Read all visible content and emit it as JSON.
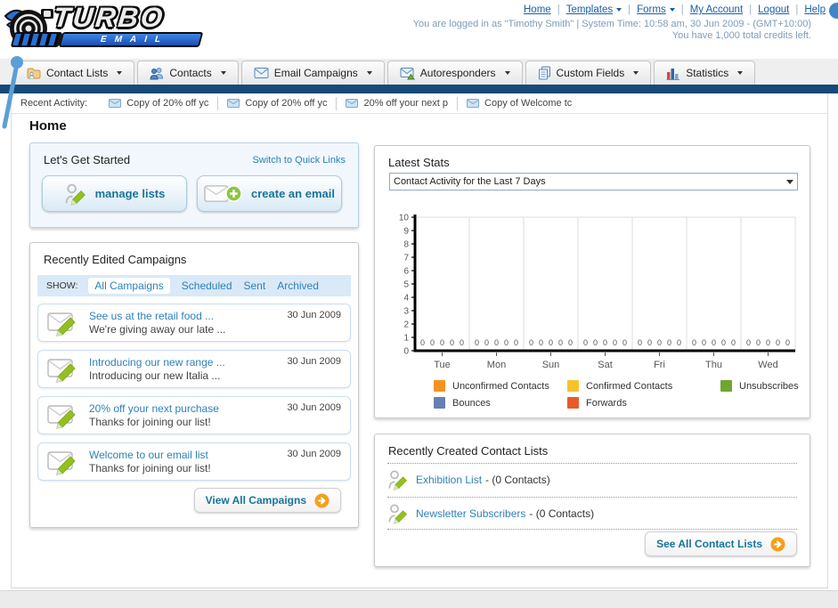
{
  "colors": {
    "navy_bar": "#164a79",
    "link_blue": "#1a5fa8",
    "teal_link": "#2e81b8",
    "go_arrow_orange": "#f5a01a",
    "panel_blue_bg": "#f1f7fc",
    "tabstrip_blue": "#d9e9f7"
  },
  "header": {
    "logo_line1": "TURBO",
    "logo_line2": "EMAIL",
    "nav": [
      {
        "label": "Home"
      },
      {
        "label": "Templates"
      },
      {
        "label": "Forms"
      },
      {
        "label": "My Account"
      },
      {
        "label": "Logout"
      },
      {
        "label": "Help"
      }
    ],
    "login_line": "You are logged in as \"Timothy Smith\" | System Time: 10:58 am, 30 Jun 2009 - (GMT+10:00)",
    "credits_line": "You have 1,000 total credits left."
  },
  "main_nav": {
    "tabs": [
      {
        "label": "Contact Lists",
        "icon": "contact-lists-folder-icon"
      },
      {
        "label": "Contacts",
        "icon": "contacts-people-icon"
      },
      {
        "label": "Email Campaigns",
        "icon": "email-envelope-icon"
      },
      {
        "label": "Autoresponders",
        "icon": "autoresponder-envelope-icon"
      },
      {
        "label": "Custom Fields",
        "icon": "custom-fields-pages-icon"
      },
      {
        "label": "Statistics",
        "icon": "statistics-bars-icon"
      }
    ]
  },
  "recent_activity": {
    "label": "Recent Activity:",
    "items": [
      {
        "text": "Copy of 20% off yc"
      },
      {
        "text": "Copy of 20% off yc"
      },
      {
        "text": "20% off your next p"
      },
      {
        "text": "Copy of Welcome tc"
      }
    ]
  },
  "page": {
    "title": "Home"
  },
  "get_started": {
    "title": "Let's Get Started",
    "switch_link": "Switch to Quick Links",
    "manage_lists_label": "manage lists",
    "create_email_label": "create an email"
  },
  "campaigns": {
    "title": "Recently Edited Campaigns",
    "show_label": "SHOW:",
    "tabs": [
      {
        "label": "All Campaigns",
        "active": true
      },
      {
        "label": "Scheduled",
        "active": false
      },
      {
        "label": "Sent",
        "active": false
      },
      {
        "label": "Archived",
        "active": false
      }
    ],
    "items": [
      {
        "title": "See us at the retail food ...",
        "subtitle": "We're giving away our late ...",
        "date": "30 Jun 2009"
      },
      {
        "title": "Introducing our new range ...",
        "subtitle": "Introducing our new Italia ...",
        "date": "30 Jun 2009"
      },
      {
        "title": "20% off your next purchase",
        "subtitle": "Thanks for joining our list!",
        "date": "30 Jun 2009"
      },
      {
        "title": "Welcome to our email list",
        "subtitle": "Thanks for joining our list!",
        "date": "30 Jun 2009"
      }
    ],
    "view_all_label": "View All Campaigns"
  },
  "latest_stats": {
    "title": "Latest Stats",
    "dropdown_value": "Contact Activity for the Last 7 Days"
  },
  "chart_data": {
    "type": "bar",
    "title": "Contact Activity for the Last 7 Days",
    "categories": [
      "Tue",
      "Mon",
      "Sun",
      "Sat",
      "Fri",
      "Thu",
      "Wed"
    ],
    "series": [
      {
        "name": "Unconfirmed Contacts",
        "color": "#f6921e",
        "values": [
          0,
          0,
          0,
          0,
          0,
          0,
          0
        ]
      },
      {
        "name": "Confirmed Contacts",
        "color": "#f8c32a",
        "values": [
          0,
          0,
          0,
          0,
          0,
          0,
          0
        ]
      },
      {
        "name": "Unsubscribes",
        "color": "#71a530",
        "values": [
          0,
          0,
          0,
          0,
          0,
          0,
          0
        ]
      },
      {
        "name": "Bounces",
        "color": "#6680b2",
        "values": [
          0,
          0,
          0,
          0,
          0,
          0,
          0
        ]
      },
      {
        "name": "Forwards",
        "color": "#e75b2b",
        "values": [
          0,
          0,
          0,
          0,
          0,
          0,
          0
        ]
      }
    ],
    "ylim": [
      0,
      10
    ],
    "yticks": [
      0,
      1,
      2,
      3,
      4,
      5,
      6,
      7,
      8,
      9,
      10
    ],
    "grid": "vertical",
    "legend_position": "bottom",
    "value_labels_shown": true
  },
  "contact_lists": {
    "title": "Recently Created Contact Lists",
    "items": [
      {
        "name": "Exhibition List",
        "count_text": "- (0 Contacts)"
      },
      {
        "name": "Newsletter Subscribers",
        "count_text": "- (0 Contacts)"
      }
    ],
    "see_all_label": "See All Contact Lists"
  }
}
